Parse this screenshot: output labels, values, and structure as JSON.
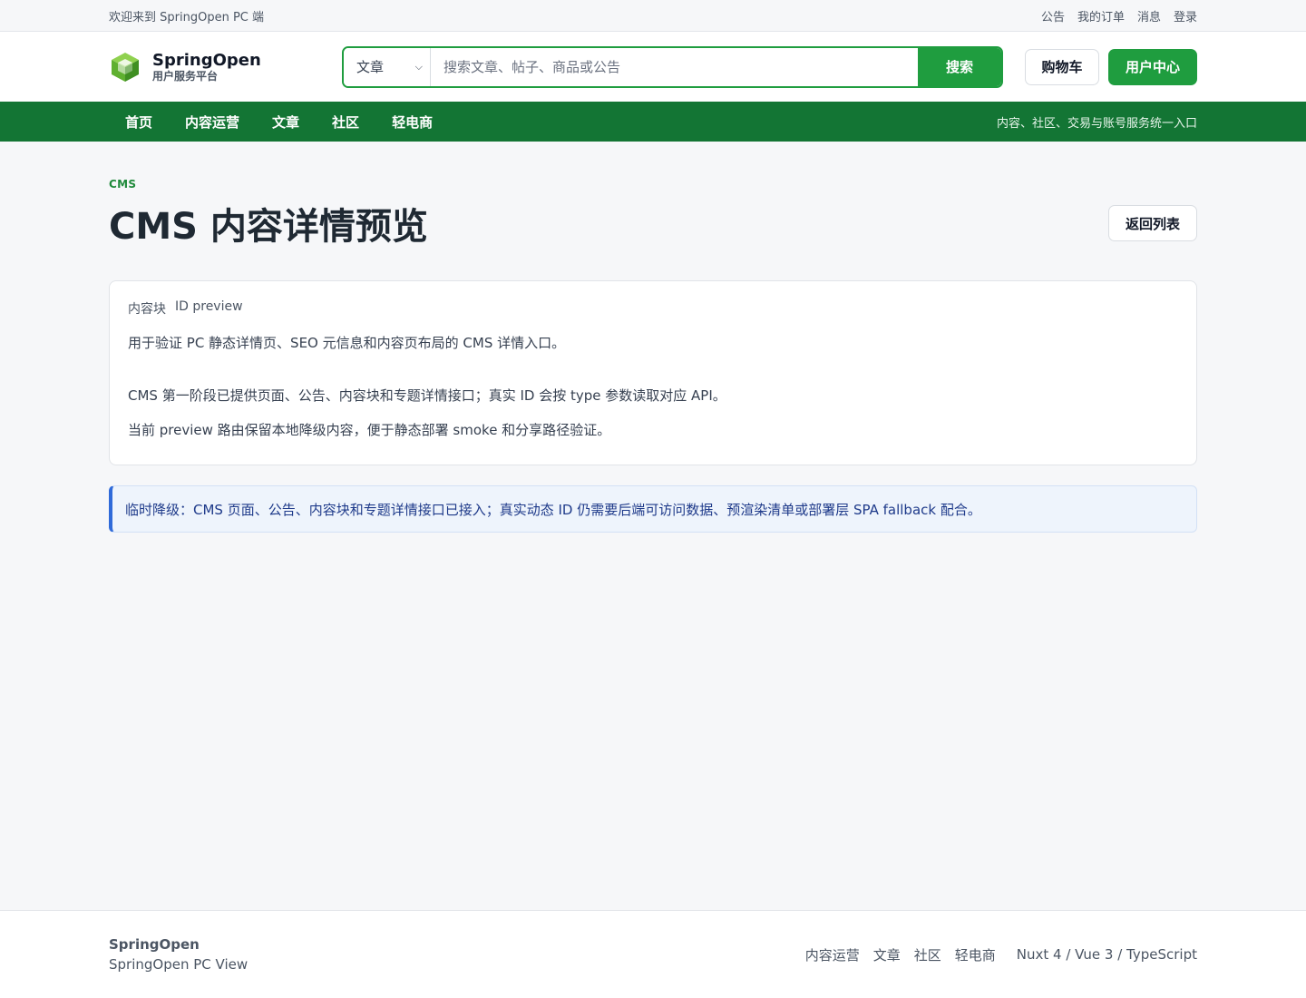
{
  "topbar": {
    "welcome": "欢迎来到 SpringOpen PC 端",
    "links": [
      "公告",
      "我的订单",
      "消息",
      "登录"
    ]
  },
  "header": {
    "brand_name": "SpringOpen",
    "brand_sub": "用户服务平台",
    "search_scope": "文章",
    "search_placeholder": "搜索文章、帖子、商品或公告",
    "search_button": "搜索",
    "cart_button": "购物车",
    "user_center_button": "用户中心"
  },
  "nav": {
    "items": [
      "首页",
      "内容运营",
      "文章",
      "社区",
      "轻电商"
    ],
    "tagline": "内容、社区、交易与账号服务统一入口"
  },
  "main": {
    "eyebrow": "CMS",
    "title": "CMS 内容详情预览",
    "back_button": "返回列表",
    "card": {
      "type_label": "内容块",
      "id_label": "ID preview",
      "summary": "用于验证 PC 静态详情页、SEO 元信息和内容页布局的 CMS 详情入口。",
      "body": [
        "CMS 第一阶段已提供页面、公告、内容块和专题详情接口；真实 ID 会按 type 参数读取对应 API。",
        "当前 preview 路由保留本地降级内容，便于静态部署 smoke 和分享路径验证。"
      ]
    },
    "notice": "临时降级：CMS 页面、公告、内容块和专题详情接口已接入；真实动态 ID 仍需要后端可访问数据、预渲染清单或部署层 SPA fallback 配合。"
  },
  "footer": {
    "brand": "SpringOpen",
    "sub": "SpringOpen PC View",
    "links": [
      "内容运营",
      "文章",
      "社区",
      "轻电商"
    ],
    "stack": "Nuxt 4 / Vue 3 / TypeScript"
  },
  "colors": {
    "primary": "#1f9d3f",
    "nav_bg": "#137534",
    "notice_accent": "#2f6ad9",
    "page_bg": "#f6f7f9"
  }
}
